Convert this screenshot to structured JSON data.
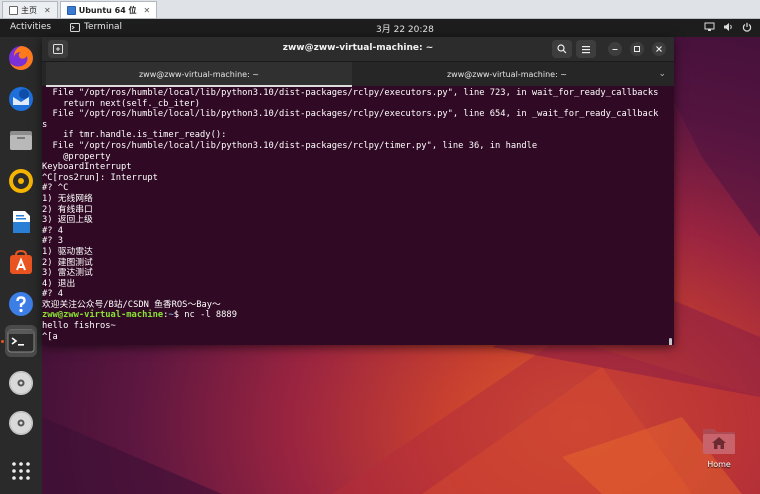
{
  "vm_tabs": [
    {
      "label": "主页",
      "active": false
    },
    {
      "label": "Ubuntu 64 位",
      "active": true
    }
  ],
  "topbar": {
    "activities": "Activities",
    "app_name": "Terminal",
    "clock": "3月 22  20:28"
  },
  "terminal": {
    "title": "zww@zww-virtual-machine: ~",
    "tabs": [
      {
        "label": "zww@zww-virtual-machine: ~",
        "active": true
      },
      {
        "label": "zww@zww-virtual-machine: ~",
        "active": false
      }
    ],
    "lines": [
      "  File \"/opt/ros/humble/local/lib/python3.10/dist-packages/rclpy/executors.py\", line 723, in wait_for_ready_callbacks",
      "    return next(self._cb_iter)",
      "  File \"/opt/ros/humble/local/lib/python3.10/dist-packages/rclpy/executors.py\", line 654, in _wait_for_ready_callback",
      "s",
      "    if tmr.handle.is_timer_ready():",
      "  File \"/opt/ros/humble/local/lib/python3.10/dist-packages/rclpy/timer.py\", line 36, in handle",
      "    @property",
      "KeyboardInterrupt",
      "^C[ros2run]: Interrupt",
      "#? ^C",
      "1) 无线网络",
      "2) 有线串口",
      "3) 返回上级",
      "#? 4",
      "#? 3",
      "1) 驱动雷达",
      "2) 建图测试",
      "3) 雷达测试",
      "4) 退出",
      "#? 4",
      "欢迎关注公众号/B站/CSDN 鱼香ROS～Bay～"
    ],
    "prompt_user": "zww@zww-virtual-machine",
    "prompt_path": "~",
    "command": "nc -l 8889",
    "output_lines": [
      "hello fishros~",
      "^[a"
    ]
  },
  "desktop": {
    "home_label": "Home"
  },
  "dock_icons": [
    "firefox-icon",
    "thunderbird-icon",
    "files-icon",
    "rhythmbox-icon",
    "writer-icon",
    "software-icon",
    "help-icon",
    "terminal-icon",
    "disc-icon",
    "disc-icon",
    "app-grid-icon"
  ],
  "colors": {
    "terminal_bg": "#300a24",
    "prompt_user": "#8ae234",
    "prompt_path": "#729fcf",
    "accent": "#e95420"
  }
}
